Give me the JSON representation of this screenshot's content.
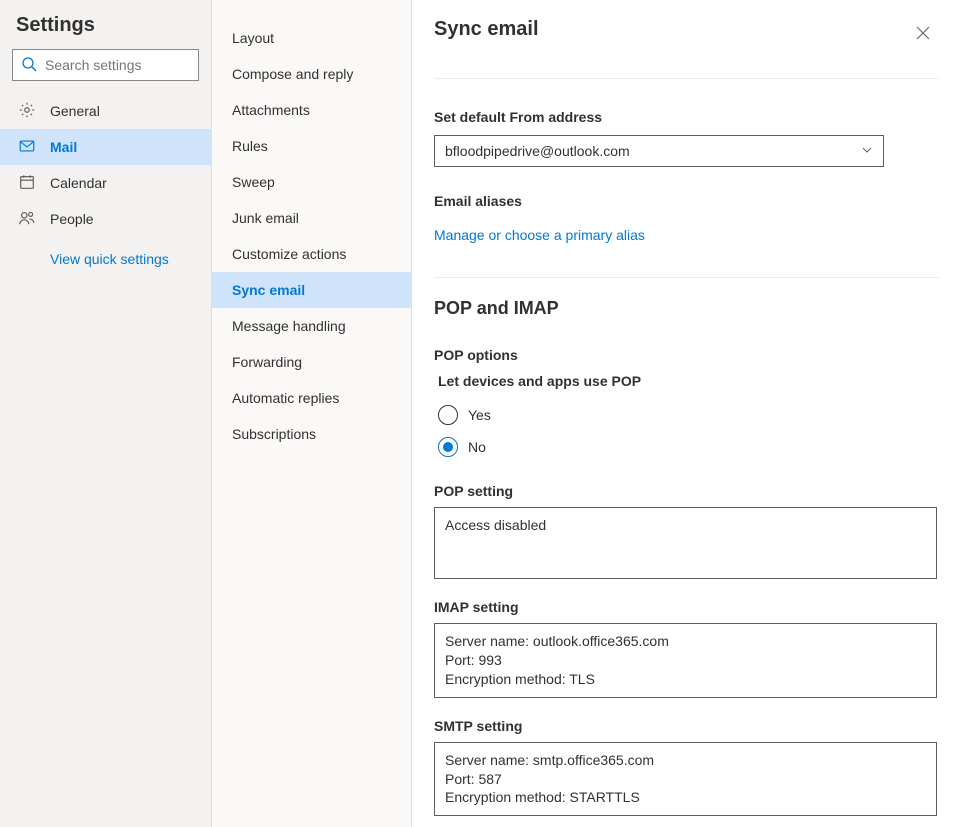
{
  "settings_title": "Settings",
  "search_placeholder": "Search settings",
  "nav1": {
    "general": "General",
    "mail": "Mail",
    "calendar": "Calendar",
    "people": "People",
    "quick": "View quick settings"
  },
  "nav2": {
    "layout": "Layout",
    "compose": "Compose and reply",
    "attachments": "Attachments",
    "rules": "Rules",
    "sweep": "Sweep",
    "junk": "Junk email",
    "customize": "Customize actions",
    "sync": "Sync email",
    "messagehandling": "Message handling",
    "forwarding": "Forwarding",
    "autoreplies": "Automatic replies",
    "subscriptions": "Subscriptions"
  },
  "content": {
    "title": "Sync email",
    "from_label": "Set default From address",
    "from_value": "bfloodpipedrive@outlook.com",
    "aliases_label": "Email aliases",
    "aliases_link": "Manage or choose a primary alias",
    "popimap_title": "POP and IMAP",
    "pop_options": "POP options",
    "pop_question": "Let devices and apps use POP",
    "yes": "Yes",
    "no": "No",
    "pop_setting_label": "POP setting",
    "pop_setting_value": "Access disabled",
    "imap_setting_label": "IMAP setting",
    "imap_server": "Server name: outlook.office365.com",
    "imap_port": "Port: 993",
    "imap_enc": "Encryption method: TLS",
    "smtp_setting_label": "SMTP setting",
    "smtp_server": "Server name: smtp.office365.com",
    "smtp_port": "Port: 587",
    "smtp_enc": "Encryption method: STARTTLS"
  }
}
